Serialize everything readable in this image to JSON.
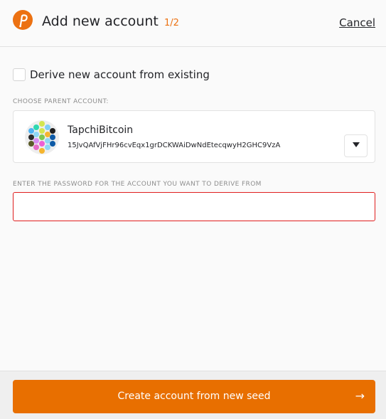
{
  "header": {
    "title": "Add new account",
    "step": "1/2",
    "cancel_label": "Cancel",
    "logo_icon": "polkadot-logo-icon"
  },
  "derive": {
    "label": "Derive new account from existing",
    "checked": false
  },
  "parent": {
    "section_label": "CHOOSE PARENT ACCOUNT:",
    "account_name": "TapchiBitcoin",
    "account_address": "15JvQAfVjFHr96cvEqx1grDCKWAiDwNdEtecqwyH2GHC9VzA",
    "dropdown_icon": "chevron-down-icon"
  },
  "password": {
    "section_label": "ENTER THE PASSWORD FOR THE ACCOUNT YOU WANT TO DERIVE FROM",
    "value": ""
  },
  "footer": {
    "create_label": "Create account from new seed",
    "arrow": "→"
  },
  "colors": {
    "accent": "#e86f00",
    "error_border": "#e01e1e"
  }
}
